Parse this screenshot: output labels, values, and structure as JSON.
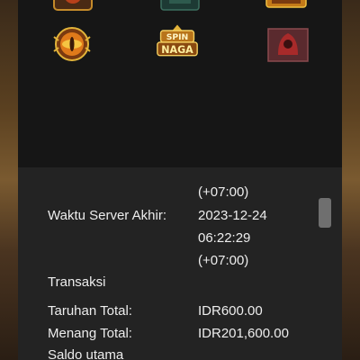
{
  "games": [
    {
      "name": "dragon-eye-game-icon",
      "label": ""
    },
    {
      "name": "spin-naga-game-icon",
      "label": "SPIN NAGA"
    },
    {
      "name": "red-shrine-game-icon",
      "label": ""
    }
  ],
  "server": {
    "start_tz": "(+07:00)",
    "end_label": "Waktu Server Akhir:",
    "end_date": "2023-12-24",
    "end_time": "06:22:29",
    "end_tz": "(+07:00)"
  },
  "transactions": {
    "heading": "Transaksi",
    "bet_label": "Taruhan Total:",
    "bet_value": "IDR600.00",
    "win_label": "Menang Total:",
    "win_value": "IDR201,600.00"
  },
  "balance": {
    "heading": "Saldo utama"
  },
  "colors": {
    "panel": "#171717",
    "info_bg": "#232323",
    "text": "#ededed",
    "gold": "#e3b43a",
    "scrollbar": "#6f6f6f"
  }
}
